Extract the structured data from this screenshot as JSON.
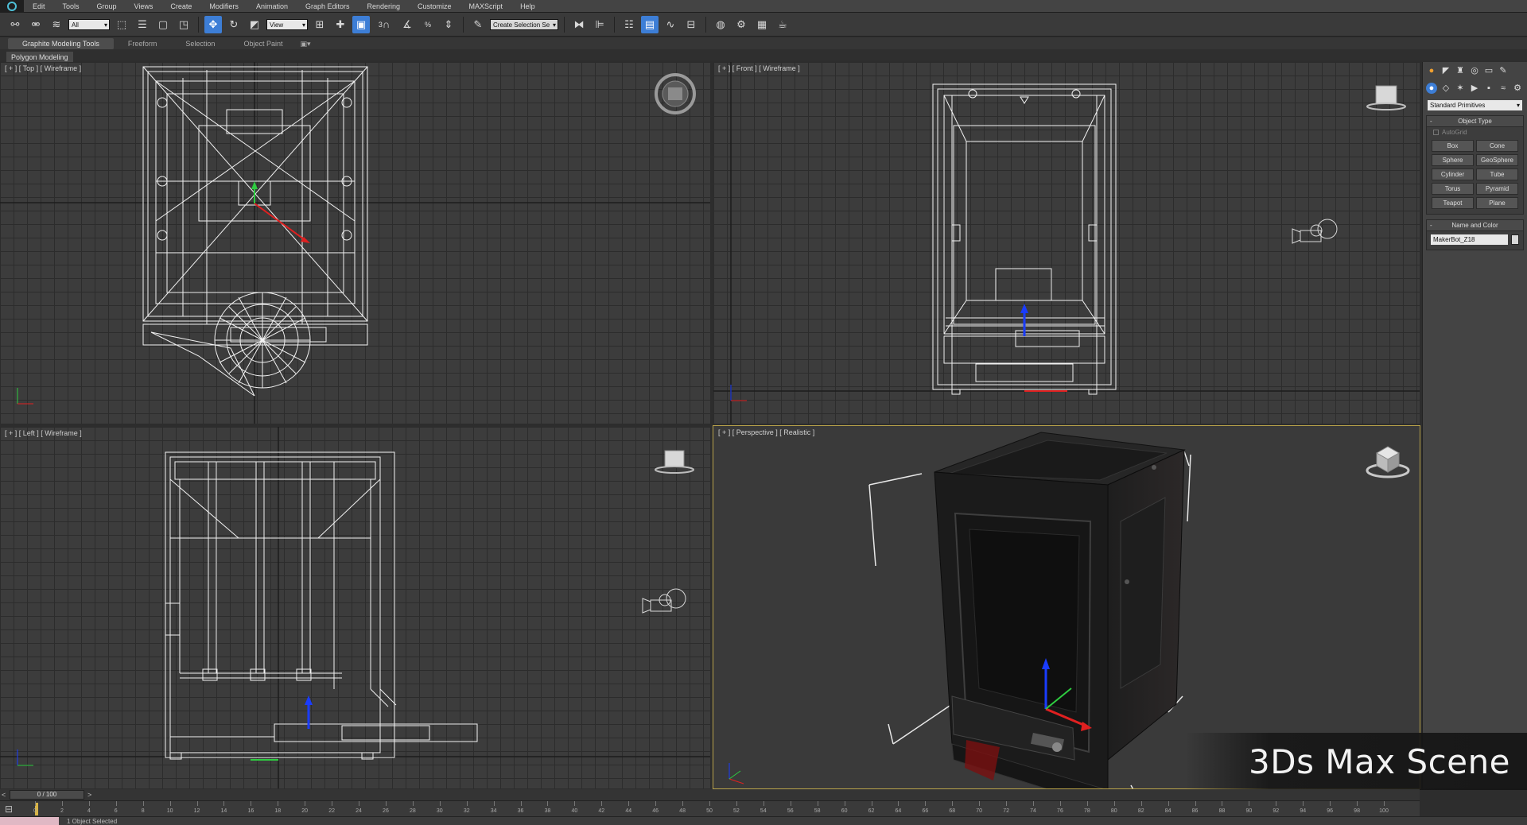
{
  "menu": [
    "Edit",
    "Tools",
    "Group",
    "Views",
    "Create",
    "Modifiers",
    "Animation",
    "Graph Editors",
    "Rendering",
    "Customize",
    "MAXScript",
    "Help"
  ],
  "toolbar": {
    "filter": "All",
    "ref_coord": "View",
    "selection_set": "Create Selection Se",
    "snap": "3",
    "angle": "%"
  },
  "ribbon": {
    "tabs": [
      "Graphite Modeling Tools",
      "Freeform",
      "Selection",
      "Object Paint"
    ],
    "panel": "Polygon Modeling"
  },
  "viewports": {
    "top": "[ + ] [ Top ] [ Wireframe ]",
    "front": "[ + ] [ Front ] [ Wireframe ]",
    "left": "[ + ] [ Left ] [ Wireframe ]",
    "perspective": "[ + ] [ Perspective ] [ Realistic ]"
  },
  "command_panel": {
    "category": "Standard Primitives",
    "object_type_title": "Object Type",
    "autogrid": "AutoGrid",
    "buttons": [
      "Box",
      "Cone",
      "Sphere",
      "GeoSphere",
      "Cylinder",
      "Tube",
      "Torus",
      "Pyramid",
      "Teapot",
      "Plane"
    ],
    "name_color_title": "Name and Color",
    "object_name": "MakerBot_Z18"
  },
  "timeline": {
    "frame": "0 / 100",
    "ticks": [
      "0",
      "2",
      "4",
      "6",
      "8",
      "10",
      "12",
      "14",
      "16",
      "18",
      "20",
      "22",
      "24",
      "26",
      "28",
      "30",
      "32",
      "34",
      "36",
      "38",
      "40",
      "42",
      "44",
      "46",
      "48",
      "50",
      "52",
      "54",
      "56",
      "58",
      "60",
      "62",
      "64",
      "66",
      "68",
      "70",
      "72",
      "74",
      "76",
      "78",
      "80",
      "82",
      "84",
      "86",
      "88",
      "90",
      "92",
      "94",
      "96",
      "98",
      "100"
    ]
  },
  "status": {
    "selection": "1 Object Selected"
  },
  "caption": "3Ds Max Scene"
}
